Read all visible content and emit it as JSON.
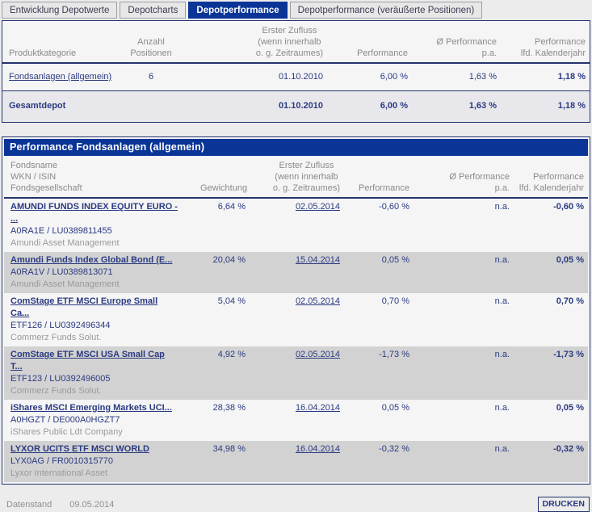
{
  "colors": {
    "accent_navy": "#0a3597",
    "text_navy": "#2b3a80",
    "border_navy": "#23346e",
    "row_alt_gray": "#d2d2d2",
    "muted_gray": "#9a9a9a",
    "page_bg": "#ececec"
  },
  "tabs": [
    {
      "label": "Entwicklung Depotwerte",
      "active": false
    },
    {
      "label": "Depotcharts",
      "active": false
    },
    {
      "label": "Depotperformance",
      "active": true
    },
    {
      "label": "Depotperformance (veräußerte Positionen)",
      "active": false
    }
  ],
  "summary_table": {
    "headers": [
      "Produktkategorie",
      "Anzahl\nPositionen",
      "Erster Zufluss\n(wenn innerhalb\no. g. Zeitraumes)",
      "Performance",
      "Ø Performance\np.a.",
      "Performance\nlfd. Kalenderjahr"
    ],
    "rows": [
      {
        "category": "Fondsanlagen (allgemein)",
        "category_is_link": true,
        "total": false,
        "positions": "6",
        "first_inflow": "01.10.2010",
        "performance": "6,00 %",
        "performance_pa": "1,63 %",
        "performance_ytd": "1,18 %"
      },
      {
        "category": "Gesamtdepot",
        "category_is_link": false,
        "total": true,
        "positions": "",
        "first_inflow": "01.10.2010",
        "performance": "6,00 %",
        "performance_pa": "1,63 %",
        "performance_ytd": "1,18 %"
      }
    ]
  },
  "detail_table": {
    "title": "Performance Fondsanlagen (allgemein)",
    "headers": [
      "Fondsname\nWKN / ISIN\nFondsgesellschaft",
      "Gewichtung",
      "Erster Zufluss\n(wenn innerhalb\no. g. Zeitraumes)",
      "Performance",
      "Ø Performance\np.a.",
      "Performance\nlfd. Kalenderjahr"
    ],
    "rows": [
      {
        "name": "AMUNDI FUNDS INDEX EQUITY EURO -\n...",
        "wkn_isin": "A0RA1E /  LU0389811455",
        "company": "Amundi Asset Management",
        "weight": "6,64 %",
        "first_inflow": "02.05.2014",
        "performance": "-0,60 %",
        "performance_pa": "n.a.",
        "performance_ytd": "-0,60 %"
      },
      {
        "name": "Amundi Funds Index Global Bond (E...",
        "wkn_isin": "A0RA1V /  LU0389813071",
        "company": "Amundi Asset Management",
        "weight": "20,04 %",
        "first_inflow": "15.04.2014",
        "performance": "0,05 %",
        "performance_pa": "n.a.",
        "performance_ytd": "0,05 %"
      },
      {
        "name": "ComStage ETF MSCI Europe Small\nCa...",
        "wkn_isin": "ETF126 /  LU0392496344",
        "company": "Commerz Funds Solut.",
        "weight": "5,04 %",
        "first_inflow": "02.05.2014",
        "performance": "0,70 %",
        "performance_pa": "n.a.",
        "performance_ytd": "0,70 %"
      },
      {
        "name": "ComStage ETF MSCI USA Small Cap\nT...",
        "wkn_isin": "ETF123 /  LU0392496005",
        "company": "Commerz Funds Solut.",
        "weight": "4,92 %",
        "first_inflow": "02.05.2014",
        "performance": "-1,73 %",
        "performance_pa": "n.a.",
        "performance_ytd": "-1,73 %"
      },
      {
        "name": "iShares MSCI Emerging Markets UCI...",
        "wkn_isin": "A0HGZT /  DE000A0HGZT7",
        "company": "iShares Public Ldt Company",
        "weight": "28,38 %",
        "first_inflow": "16.04.2014",
        "performance": "0,05 %",
        "performance_pa": "n.a.",
        "performance_ytd": "0,05 %"
      },
      {
        "name": "LYXOR UCITS ETF MSCI WORLD",
        "wkn_isin": "LYX0AG /  FR0010315770",
        "company": "Lyxor International Asset",
        "weight": "34,98 %",
        "first_inflow": "16.04.2014",
        "performance": "-0,32 %",
        "performance_pa": "n.a.",
        "performance_ytd": "-0,32 %"
      }
    ]
  },
  "footer": {
    "datenstand_label": "Datenstand",
    "datenstand_value": "09.05.2014",
    "print_label": "DRUCKEN"
  }
}
